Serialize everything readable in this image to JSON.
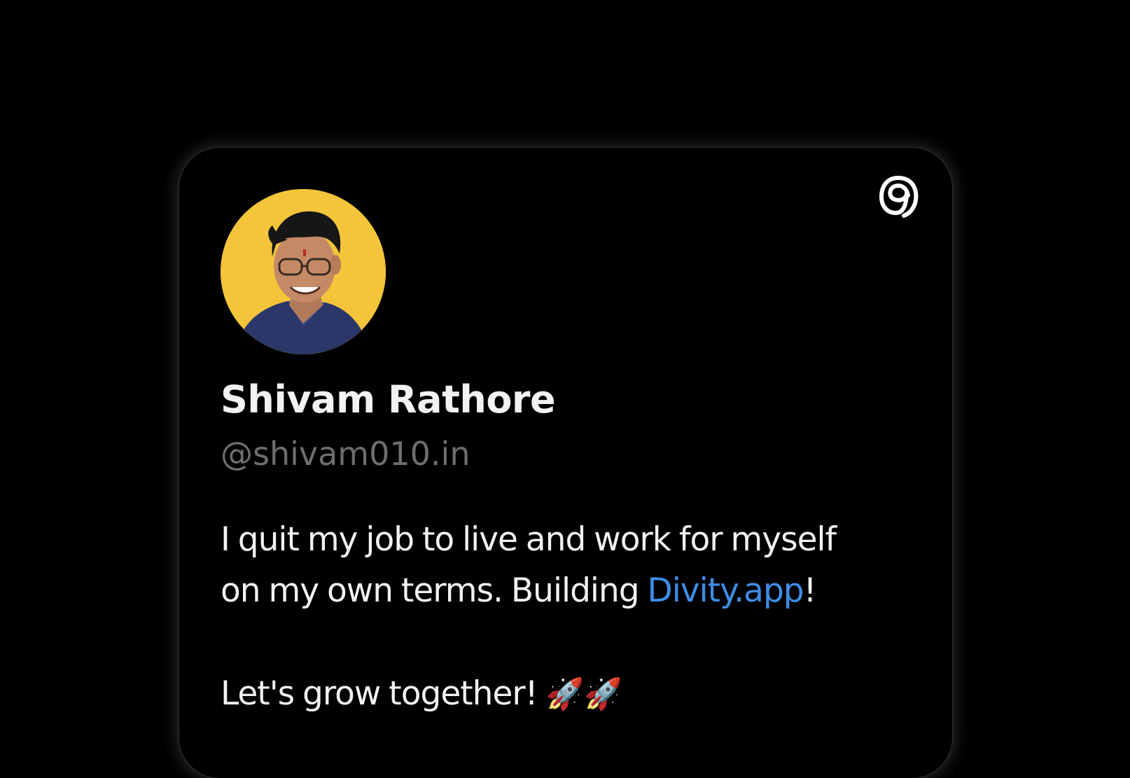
{
  "profile": {
    "display_name": "Shivam Rathore",
    "handle": "@shivam010.in",
    "bio_line1": "I quit my job to live and work for myself",
    "bio_line2_prefix": "on my own terms. Building ",
    "bio_link": "Divity.app",
    "bio_line2_suffix": "!",
    "bio_line3": "Let's grow together! ",
    "bio_emoji": "🚀🚀"
  },
  "icons": {
    "brand": "threads-logo-icon",
    "avatar": "profile-photo"
  },
  "colors": {
    "background": "#000000",
    "text": "#f2f2f2",
    "muted": "#6e6e6e",
    "link": "#3f8de6",
    "avatar_bg": "#f4c53a"
  }
}
